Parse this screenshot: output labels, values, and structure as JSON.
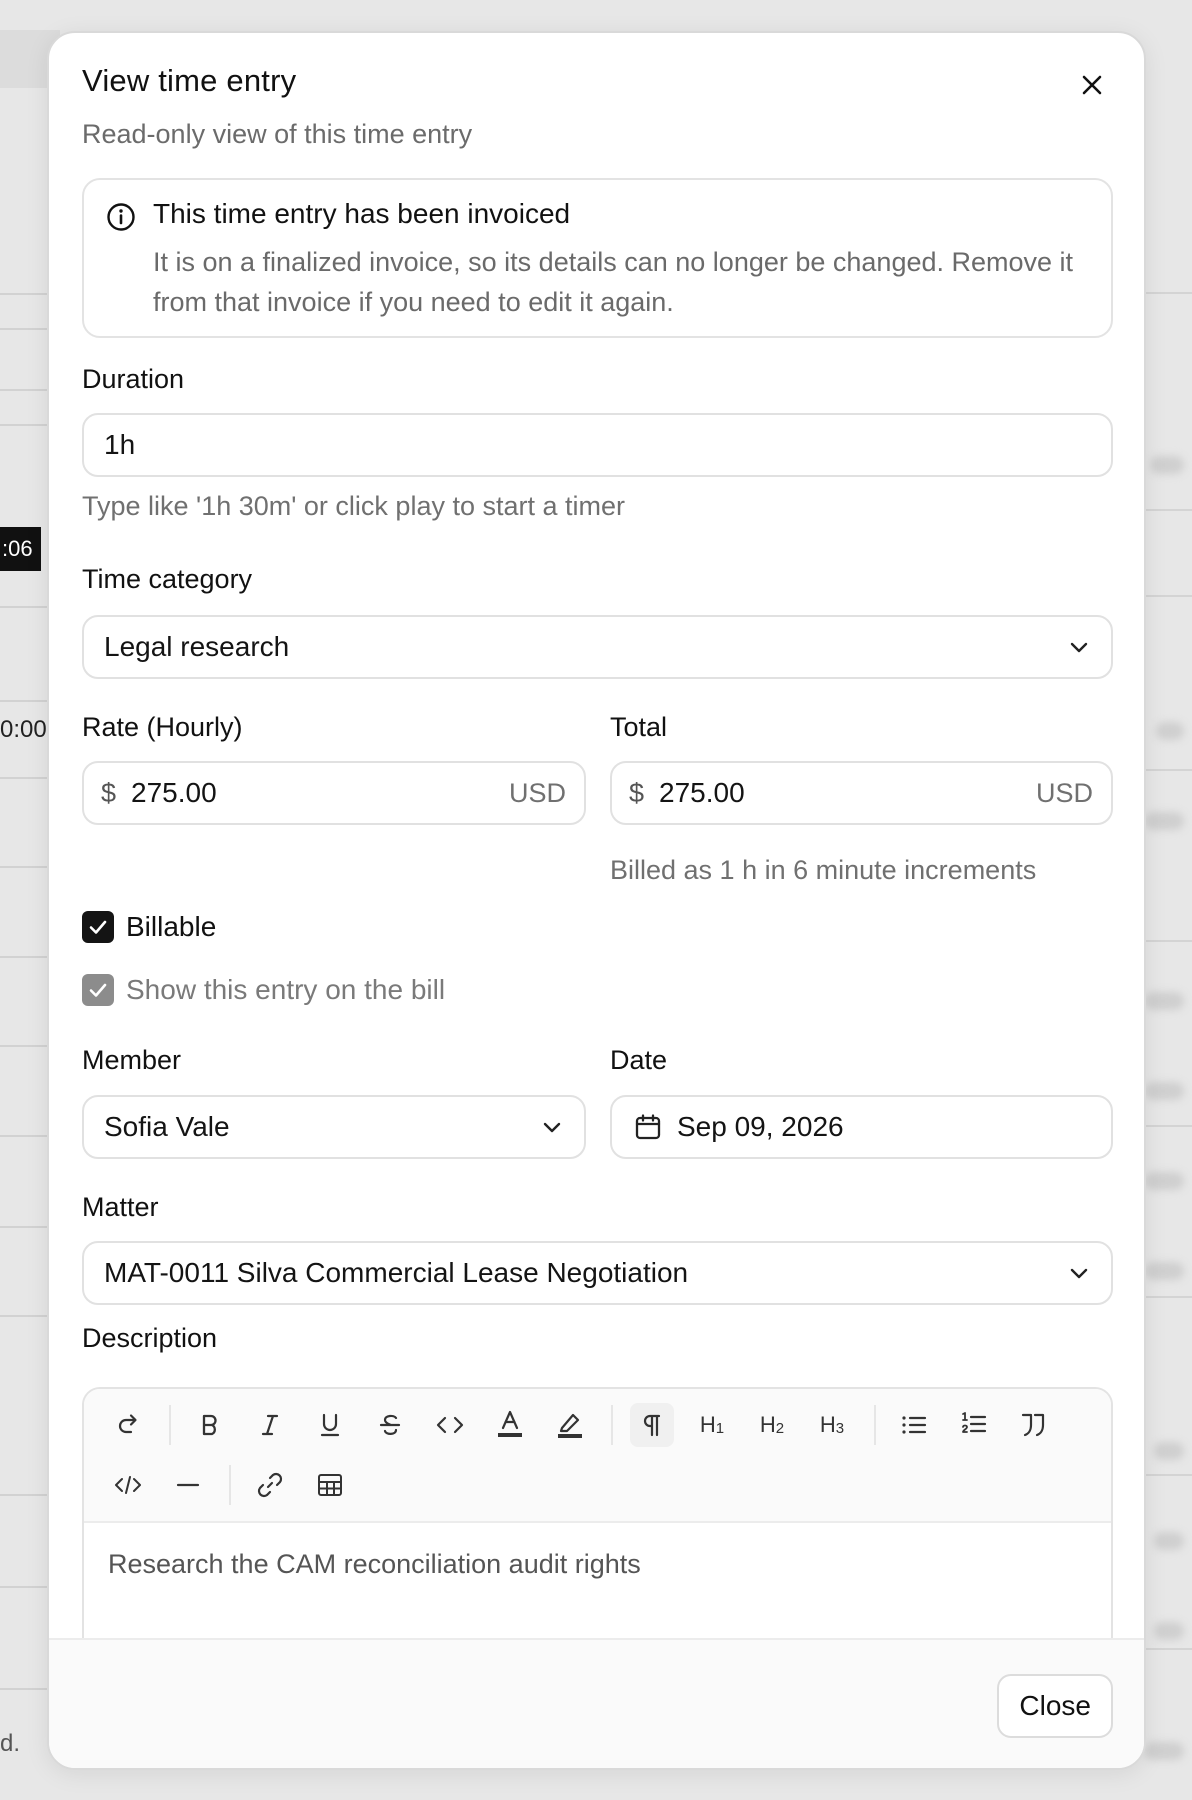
{
  "background": {
    "timer_badge": ":06",
    "time_text": "0:00",
    "footer_fragment": "d."
  },
  "modal": {
    "title": "View time entry",
    "subtitle": "Read-only view of this time entry",
    "close_icon": "close-icon",
    "alert": {
      "icon": "info-icon",
      "title": "This time entry has been invoiced",
      "body": "It is on a finalized invoice, so its details can no longer be changed. Remove it from that invoice if you need to edit it again."
    },
    "duration": {
      "label": "Duration",
      "value": "1h",
      "hint": "Type like '1h 30m' or click play to start a timer"
    },
    "time_category": {
      "label": "Time category",
      "value": "Legal research"
    },
    "rate": {
      "label": "Rate (Hourly)",
      "currency_symbol": "$",
      "value": "275.00",
      "unit": "USD"
    },
    "total": {
      "label": "Total",
      "currency_symbol": "$",
      "value": "275.00",
      "unit": "USD",
      "hint": "Billed as 1 h in 6 minute increments"
    },
    "billable": {
      "label": "Billable",
      "checked": true
    },
    "show_on_bill": {
      "label": "Show this entry on the bill",
      "checked": true,
      "disabled": true
    },
    "member": {
      "label": "Member",
      "value": "Sofia Vale"
    },
    "date": {
      "label": "Date",
      "value": "Sep 09, 2026",
      "icon": "calendar-icon"
    },
    "matter": {
      "label": "Matter",
      "value": "MAT-0011 Silva Commercial Lease Negotiation"
    },
    "description": {
      "label": "Description",
      "toolbar": [
        "redo-icon",
        "bold-icon",
        "italic-icon",
        "underline-icon",
        "strikethrough-icon",
        "code-icon",
        "text-color-icon",
        "highlight-icon",
        "paragraph-icon",
        "heading-1-icon",
        "heading-2-icon",
        "heading-3-icon",
        "bullet-list-icon",
        "ordered-list-icon",
        "blockquote-icon",
        "code-block-icon",
        "horizontal-rule-icon",
        "link-icon",
        "table-icon"
      ],
      "heading_labels": {
        "h": "H",
        "one": "1",
        "two": "2",
        "three": "3"
      },
      "content": "Research the CAM reconciliation audit rights"
    },
    "footer": {
      "close_label": "Close"
    }
  }
}
